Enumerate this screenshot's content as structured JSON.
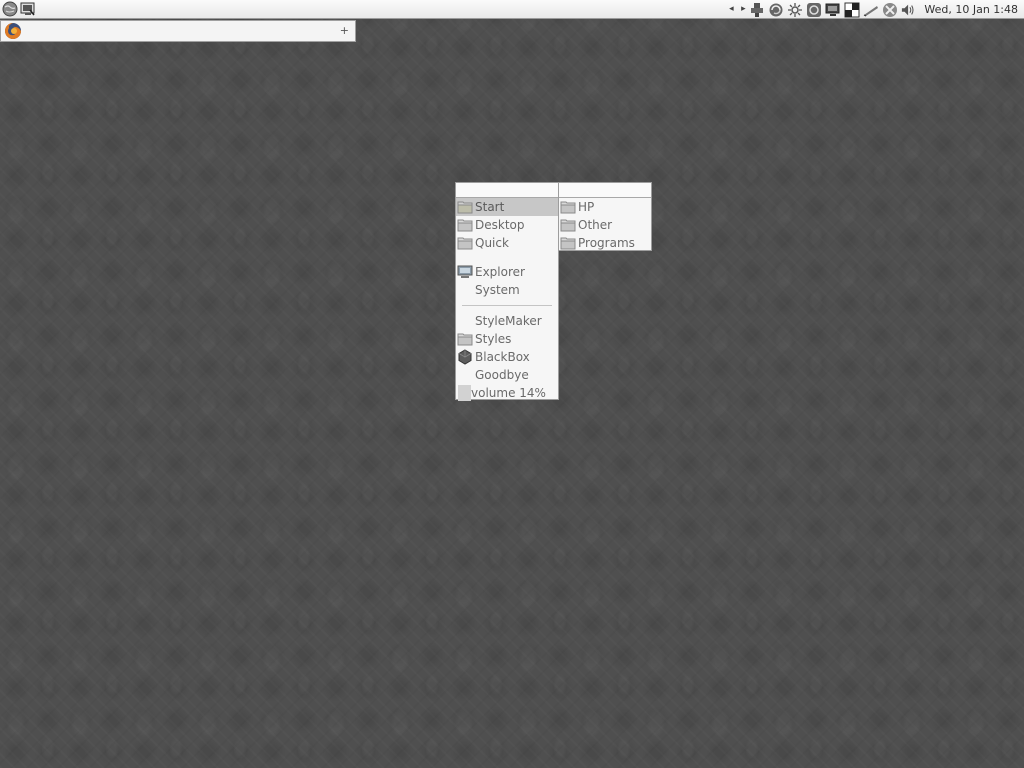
{
  "taskbar": {
    "left_icons": [
      "globe-icon",
      "terminal-icon"
    ],
    "tray": {
      "nav_left": "◂",
      "nav_right": "▸",
      "icons": [
        "network-icon",
        "refresh-icon",
        "settings-icon",
        "update-icon",
        "monitor-icon",
        "contrast-icon",
        "pen-icon",
        "blocked-icon",
        "volume-icon"
      ],
      "clock": "Wed, 10 Jan 1:48"
    }
  },
  "task_strip": {
    "task_icon": "firefox-icon",
    "plus_label": "+"
  },
  "main_menu": {
    "items": [
      {
        "label": "Start",
        "icon": "folder-icon",
        "active": true
      },
      {
        "label": "Desktop",
        "icon": "folder-icon"
      },
      {
        "label": "Quick",
        "icon": "folder-icon"
      },
      {
        "label": "Explorer",
        "icon": "computer-icon"
      },
      {
        "label": "System",
        "icon": null
      },
      {
        "label": "StyleMaker",
        "icon": null
      },
      {
        "label": "Styles",
        "icon": "folder-icon"
      },
      {
        "label": "BlackBox",
        "icon": "blackbox-icon"
      },
      {
        "label": "Goodbye",
        "icon": null
      },
      {
        "label": "volume 14%",
        "icon": "volume-bar"
      }
    ]
  },
  "sub_menu": {
    "items": [
      {
        "label": "HP",
        "icon": "folder-icon"
      },
      {
        "label": "Other",
        "icon": "folder-icon"
      },
      {
        "label": "Programs",
        "icon": "folder-icon"
      }
    ]
  },
  "volume": {
    "level_percent": 14
  },
  "colors": {
    "desktop": "#4f4f4f",
    "menu_bg": "#f6f6f6",
    "menu_text": "#6a6a6a",
    "menu_active": "#c7c7c7",
    "taskbar_bg": "#f2f2f2"
  }
}
